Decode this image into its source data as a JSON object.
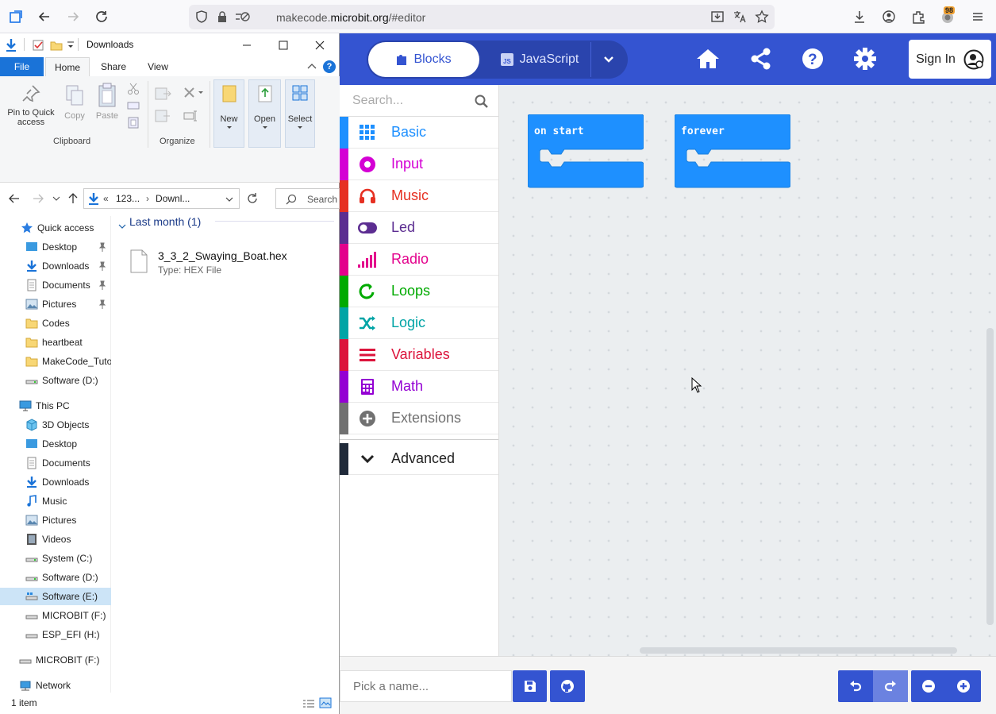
{
  "browser": {
    "url_prefix": "makecode.",
    "url_domain": "microbit.org",
    "url_path": "/#editor",
    "extensions_badge": "98"
  },
  "explorer": {
    "title": "Downloads",
    "tabs": {
      "file": "File",
      "home": "Home",
      "share": "Share",
      "view": "View"
    },
    "ribbon": {
      "pin": "Pin to Quick access",
      "copy": "Copy",
      "paste": "Paste",
      "clipboard_group": "Clipboard",
      "organize_group": "Organize",
      "new": "New",
      "open": "Open",
      "select": "Select"
    },
    "address": {
      "prefix": "«",
      "part1": "123...",
      "part2": "Downl..."
    },
    "search_placeholder": "Search",
    "nav": {
      "quick_access": "Quick access",
      "quick": [
        "Desktop",
        "Downloads",
        "Documents",
        "Pictures",
        "Codes",
        "heartbeat",
        "MakeCode_Tuto",
        "Software (D:)"
      ],
      "this_pc": "This PC",
      "pc": [
        "3D Objects",
        "Desktop",
        "Documents",
        "Downloads",
        "Music",
        "Pictures",
        "Videos",
        "System (C:)",
        "Software (D:)",
        "Software (E:)",
        "MICROBIT (F:)",
        "ESP_EFI (H:)"
      ],
      "microbit_root": "MICROBIT (F:)",
      "network": "Network"
    },
    "group_header": "Last month (1)",
    "file_name": "3_3_2_Swaying_Boat.hex",
    "file_type": "Type: HEX File",
    "status": "1 item"
  },
  "makecode": {
    "blocks_tab": "Blocks",
    "js_tab": "JavaScript",
    "signin": "Sign In",
    "search_placeholder": "Search...",
    "categories": [
      {
        "label": "Basic",
        "color": "#1e90ff"
      },
      {
        "label": "Input",
        "color": "#d400d4"
      },
      {
        "label": "Music",
        "color": "#e63022"
      },
      {
        "label": "Led",
        "color": "#5c2d91"
      },
      {
        "label": "Radio",
        "color": "#e3008c"
      },
      {
        "label": "Loops",
        "color": "#00aa00"
      },
      {
        "label": "Logic",
        "color": "#00a4a6"
      },
      {
        "label": "Variables",
        "color": "#dc143c"
      },
      {
        "label": "Math",
        "color": "#9400d3"
      },
      {
        "label": "Extensions",
        "color": "#717171"
      }
    ],
    "advanced": "Advanced",
    "blocks": {
      "on_start": "on start",
      "forever": "forever"
    },
    "name_placeholder": "Pick a name...",
    "header_color": "#3454d1",
    "block_color": "#1e90ff"
  }
}
